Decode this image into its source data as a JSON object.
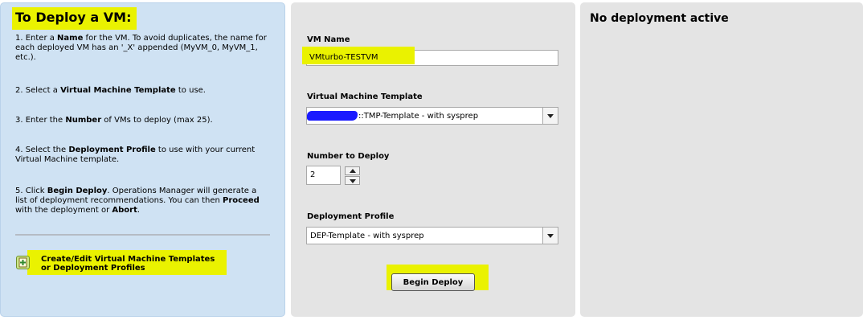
{
  "instructions": {
    "title": "To Deploy a VM:",
    "steps": [
      [
        {
          "t": "1. Enter a "
        },
        {
          "t": "Name",
          "b": true
        },
        {
          "t": " for the VM. To avoid duplicates, the name for each deployed VM has an '_X' appended (MyVM_0, MyVM_1, etc.)."
        }
      ],
      [
        {
          "t": "2. Select a "
        },
        {
          "t": "Virtual Machine Template",
          "b": true
        },
        {
          "t": " to use."
        }
      ],
      [
        {
          "t": "3. Enter the "
        },
        {
          "t": "Number",
          "b": true
        },
        {
          "t": " of VMs to deploy (max 25)."
        }
      ],
      [
        {
          "t": "4. Select the "
        },
        {
          "t": "Deployment Profile",
          "b": true
        },
        {
          "t": " to use with your current Virtual Machine template."
        }
      ],
      [
        {
          "t": "5. Click "
        },
        {
          "t": "Begin Deploy",
          "b": true
        },
        {
          "t": ". Operations Manager will generate a list of deployment recommendations. You can then "
        },
        {
          "t": "Proceed",
          "b": true
        },
        {
          "t": " with the deployment or "
        },
        {
          "t": "Abort",
          "b": true
        },
        {
          "t": "."
        }
      ]
    ],
    "templates_link_line1": "Create/Edit Virtual Machine Templates",
    "templates_link_line2": "or Deployment Profiles",
    "templates_icon": "add-template-icon"
  },
  "form": {
    "vm_name_label": "VM Name",
    "vm_name_value": "VMturbo-TESTVM",
    "template_label": "Virtual Machine Template",
    "template_value": "::TMP-Template - with sysprep",
    "number_label": "Number to Deploy",
    "number_value": "2",
    "profile_label": "Deployment Profile",
    "profile_value": "DEP-Template - with sysprep",
    "deploy_button": "Begin Deploy"
  },
  "status": {
    "title": "No deployment active"
  },
  "colors": {
    "highlight": "#eaf200",
    "left_panel_bg": "#cfe2f3",
    "panel_bg": "#e4e4e4",
    "redaction": "#1a1aff"
  }
}
